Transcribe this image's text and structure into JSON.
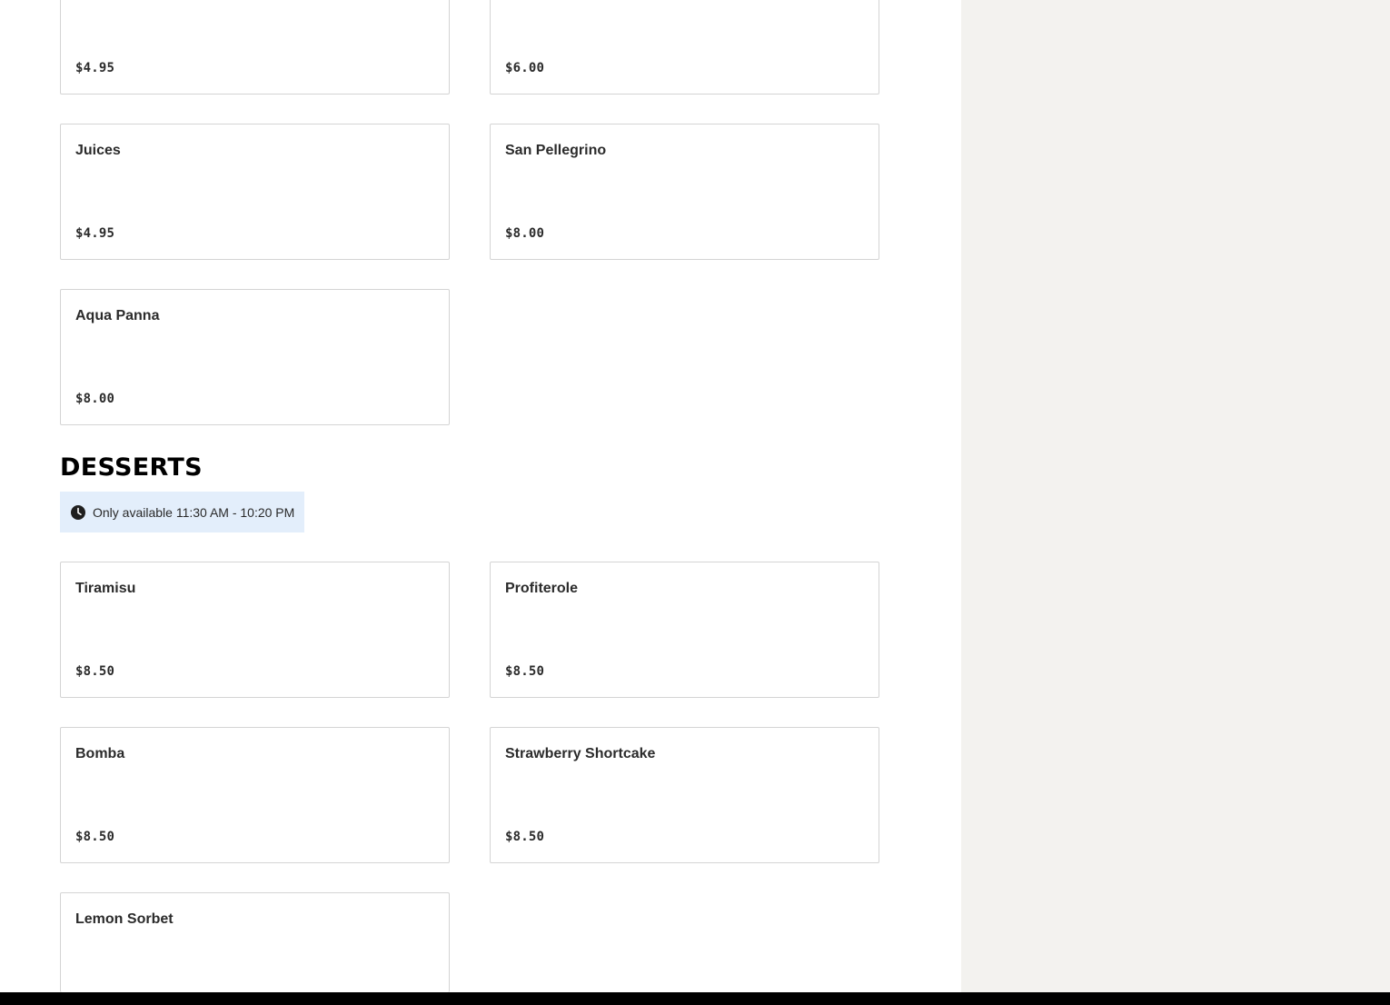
{
  "drinks": {
    "items": [
      {
        "name": "",
        "price": "$4.95"
      },
      {
        "name": "",
        "price": "$6.00"
      },
      {
        "name": "Juices",
        "price": "$4.95"
      },
      {
        "name": "San Pellegrino",
        "price": "$8.00"
      },
      {
        "name": "Aqua Panna",
        "price": "$8.00"
      }
    ]
  },
  "desserts": {
    "title": "DESSERTS",
    "availability": "Only available 11:30 AM - 10:20 PM",
    "items": [
      {
        "name": "Tiramisu",
        "price": "$8.50"
      },
      {
        "name": "Profiterole",
        "price": "$8.50"
      },
      {
        "name": "Bomba",
        "price": "$8.50"
      },
      {
        "name": "Strawberry Shortcake",
        "price": "$8.50"
      },
      {
        "name": "Lemon Sorbet",
        "price": ""
      }
    ]
  },
  "icons": {
    "availability_icon": "clock-icon"
  },
  "colors": {
    "side_panel_bg": "#f3f2ef",
    "availability_bg": "#e3eefb",
    "card_border": "#d4d4d4",
    "bottom_bar": "#000000"
  }
}
